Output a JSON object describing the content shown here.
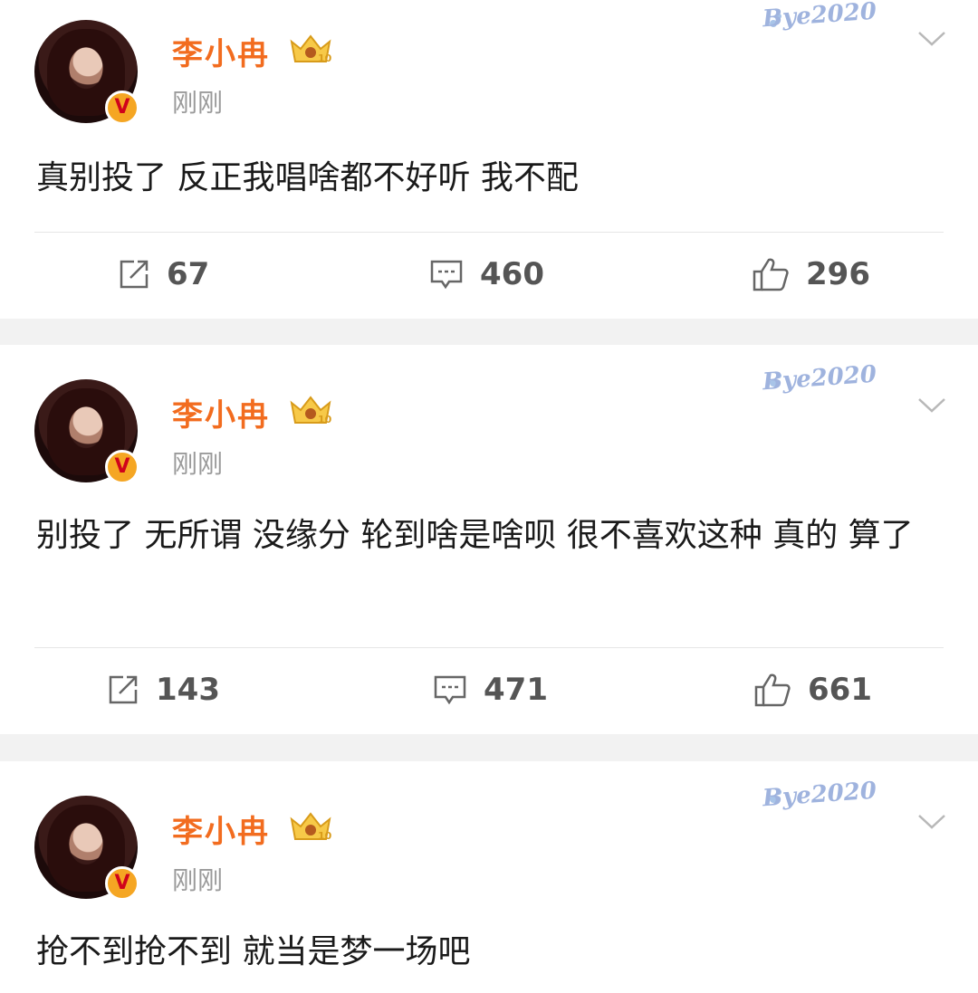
{
  "posts": [
    {
      "author": "李小冉",
      "time": "刚刚",
      "text": "真别投了 反正我唱啥都不好听 我不配",
      "reposts": "67",
      "comments": "460",
      "likes": "296"
    },
    {
      "author": "李小冉",
      "time": "刚刚",
      "text": "别投了 无所谓 没缘分 轮到啥是啥呗 很不喜欢这种 真的 算了",
      "reposts": "143",
      "comments": "471",
      "likes": "661"
    },
    {
      "author": "李小冉",
      "time": "刚刚",
      "text": "抢不到抢不到 就当是梦一场吧"
    }
  ],
  "badge": {
    "verified_mark": "V",
    "level": "10"
  },
  "watermark": "Bye2020",
  "colors": {
    "username": "#f26c1f",
    "verified": "#f5a623",
    "background": "#f2f2f2"
  },
  "icons": {
    "repost": "repost-icon",
    "comment": "comment-icon",
    "like": "like-icon",
    "more": "chevron-down-icon"
  }
}
